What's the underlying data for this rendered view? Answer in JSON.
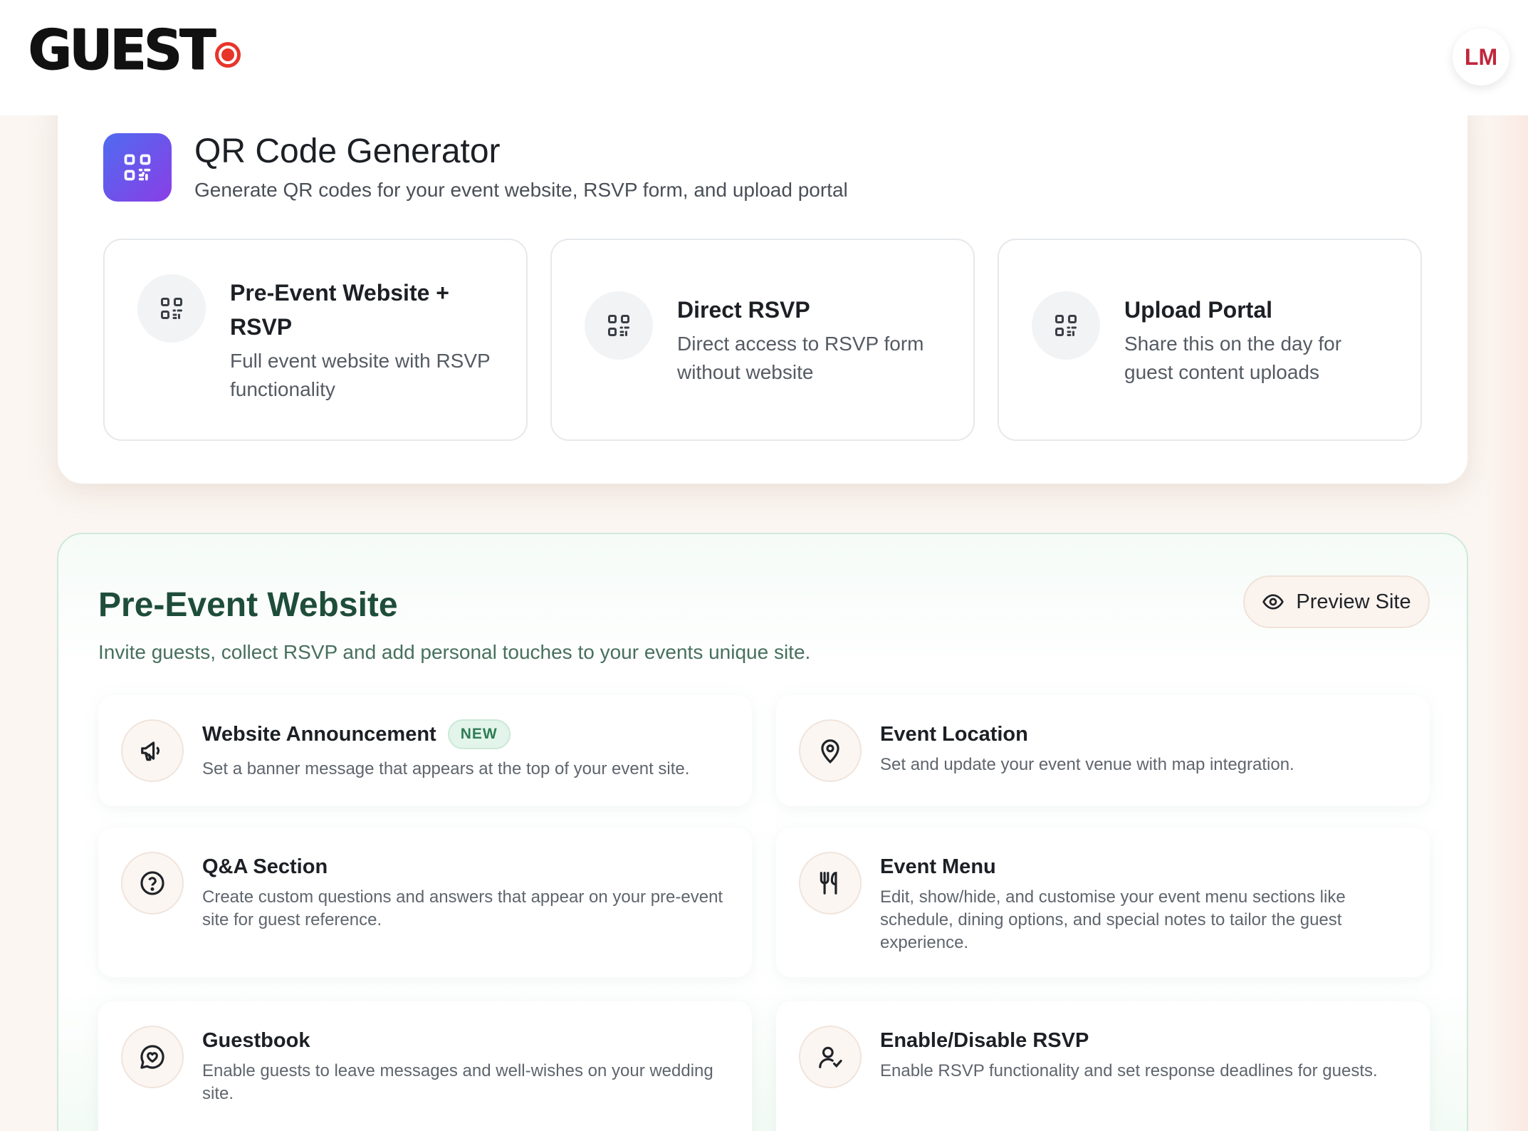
{
  "brand": {
    "logo_text": "GUEST",
    "accent": "#e8352a"
  },
  "user": {
    "initials": "LM"
  },
  "qr": {
    "title": "QR Code Generator",
    "subtitle": "Generate QR codes for your event website, RSVP form, and upload portal",
    "options": [
      {
        "title": "Pre-Event Website + RSVP",
        "description": "Full event website with RSVP functionality",
        "icon": "qr-code-icon"
      },
      {
        "title": "Direct RSVP",
        "description": "Direct access to RSVP form without website",
        "icon": "qr-code-icon"
      },
      {
        "title": "Upload Portal",
        "description": "Share this on the day for guest content uploads",
        "icon": "qr-code-icon"
      }
    ]
  },
  "website": {
    "title": "Pre-Event Website",
    "subtitle": "Invite guests, collect RSVP and add personal touches to your events unique site.",
    "preview_label": "Preview Site",
    "features": [
      {
        "title": "Website Announcement",
        "badge": "NEW",
        "description": "Set a banner message that appears at the top of your event site.",
        "icon": "megaphone-icon"
      },
      {
        "title": "Event Location",
        "description": "Set and update your event venue with map integration.",
        "icon": "map-pin-icon"
      },
      {
        "title": "Q&A Section",
        "description": "Create custom questions and answers that appear on your pre-event site for guest reference.",
        "icon": "question-circle-icon"
      },
      {
        "title": "Event Menu",
        "description": "Edit, show/hide, and customise your event menu sections like schedule, dining options, and special notes to tailor the guest experience.",
        "icon": "utensils-icon"
      },
      {
        "title": "Guestbook",
        "description": "Enable guests to leave messages and well-wishes on your wedding site.",
        "icon": "heart-message-icon"
      },
      {
        "title": "Enable/Disable RSVP",
        "description": "Enable RSVP functionality and set response deadlines for guests.",
        "icon": "user-check-icon"
      }
    ]
  }
}
